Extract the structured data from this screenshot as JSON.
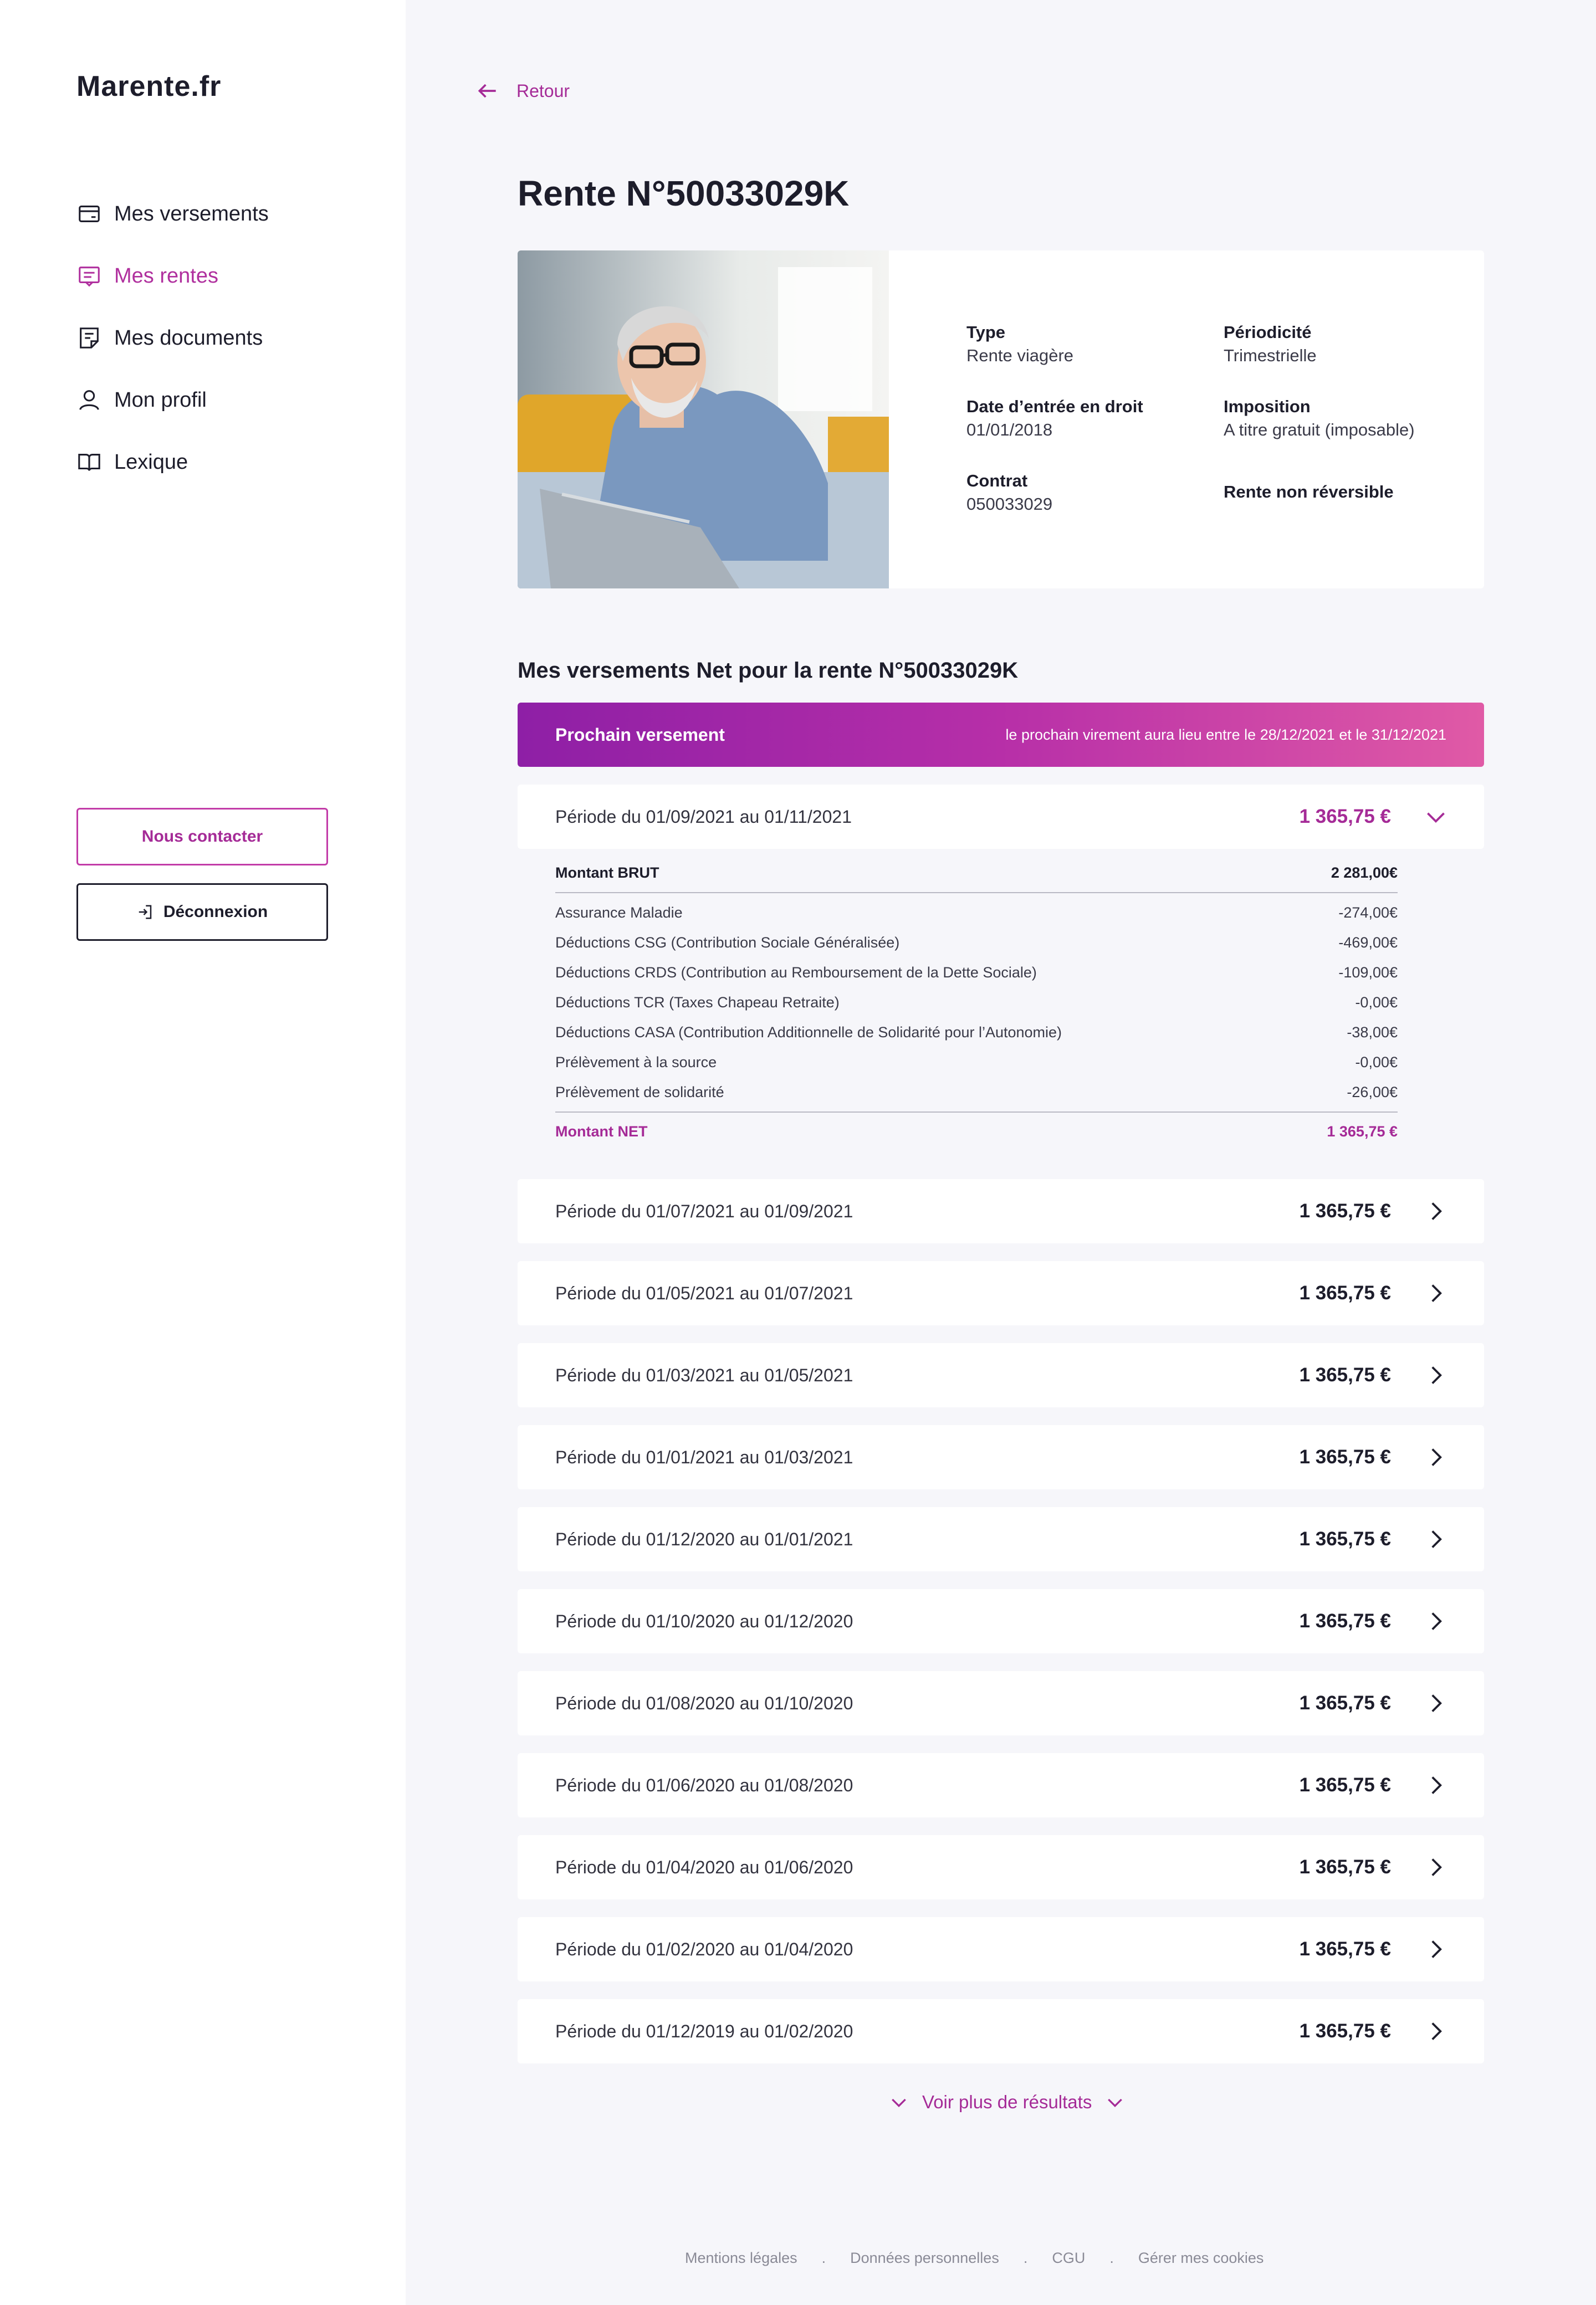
{
  "sidebar": {
    "logo": "Marente.fr",
    "items": [
      {
        "label": "Mes versements",
        "icon": "card-icon"
      },
      {
        "label": "Mes rentes",
        "icon": "document-list-icon",
        "active": true
      },
      {
        "label": "Mes documents",
        "icon": "note-icon"
      },
      {
        "label": "Mon profil",
        "icon": "user-icon"
      },
      {
        "label": "Lexique",
        "icon": "book-icon"
      }
    ],
    "contact_label": "Nous contacter",
    "logout_label": "Déconnexion"
  },
  "header": {
    "back_label": "Retour",
    "title": "Rente N°50033029K"
  },
  "info": {
    "type_label": "Type",
    "type_value": "Rente viagère",
    "periodicite_label": "Périodicité",
    "periodicite_value": "Trimestrielle",
    "date_label": "Date d’entrée en droit",
    "date_value": "01/01/2018",
    "imposition_label": "Imposition",
    "imposition_value": "A titre gratuit (imposable)",
    "contrat_label": "Contrat",
    "contrat_value": "050033029",
    "reversible_label": "Rente non réversible"
  },
  "payments": {
    "section_title": "Mes versements Net pour la rente N°50033029K",
    "next_title": "Prochain versement",
    "next_text": "le prochain virement aura lieu entre le 28/12/2021 et le 31/12/2021",
    "open_row": {
      "period": "Période du 01/09/2021 au 01/11/2021",
      "amount": "1 365,75 €"
    },
    "detail": {
      "brut_label": "Montant BRUT",
      "brut_value": "2 281,00€",
      "lines": [
        {
          "label": "Assurance Maladie",
          "value": "-274,00€"
        },
        {
          "label": "Déductions CSG (Contribution Sociale Généralisée)",
          "value": "-469,00€"
        },
        {
          "label": "Déductions CRDS (Contribution au Remboursement de la Dette Sociale)",
          "value": "-109,00€"
        },
        {
          "label": "Déductions TCR (Taxes Chapeau Retraite)",
          "value": "-0,00€"
        },
        {
          "label": "Déductions CASA (Contribution Additionnelle de Solidarité pour l’Autonomie)",
          "value": "-38,00€"
        },
        {
          "label": "Prélèvement à la source",
          "value": "-0,00€"
        },
        {
          "label": "Prélèvement de solidarité",
          "value": "-26,00€"
        }
      ],
      "net_label": "Montant NET",
      "net_value": "1 365,75 €"
    },
    "rows": [
      {
        "period": "Période du 01/07/2021 au 01/09/2021",
        "amount": "1 365,75 €"
      },
      {
        "period": "Période du 01/05/2021 au 01/07/2021",
        "amount": "1 365,75 €"
      },
      {
        "period": "Période du 01/03/2021 au 01/05/2021",
        "amount": "1 365,75 €"
      },
      {
        "period": "Période du 01/01/2021 au 01/03/2021",
        "amount": "1 365,75 €"
      },
      {
        "period": "Période du 01/12/2020 au 01/01/2021",
        "amount": "1 365,75 €"
      },
      {
        "period": "Période du 01/10/2020 au 01/12/2020",
        "amount": "1 365,75 €"
      },
      {
        "period": "Période du 01/08/2020 au 01/10/2020",
        "amount": "1 365,75 €"
      },
      {
        "period": "Période du 01/06/2020 au 01/08/2020",
        "amount": "1 365,75 €"
      },
      {
        "period": "Période du 01/04/2020 au 01/06/2020",
        "amount": "1 365,75 €"
      },
      {
        "period": "Période du 01/02/2020 au 01/04/2020",
        "amount": "1 365,75 €"
      },
      {
        "period": "Période du 01/12/2019 au 01/02/2020",
        "amount": "1 365,75 €"
      }
    ],
    "more_label": "Voir plus de résultats"
  },
  "footer": {
    "links": [
      "Mentions légales",
      "Données personnelles",
      "CGU",
      "Gérer mes cookies"
    ],
    "separator": "."
  },
  "colors": {
    "accent": "#a52b97",
    "banner_start": "#8e1fa6",
    "banner_end": "#e05aa6",
    "text": "#1d1d2b",
    "background": "#f6f6fa"
  }
}
